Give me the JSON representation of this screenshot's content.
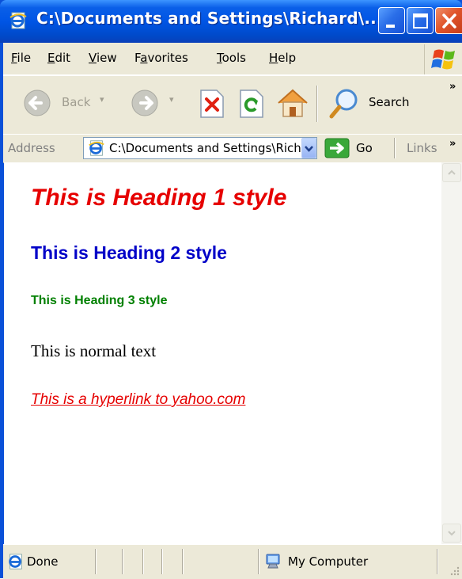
{
  "window": {
    "title": "C:\\Documents and Settings\\Richard\\..."
  },
  "menu": [
    {
      "label": "File",
      "accel": "F",
      "rest": "ile"
    },
    {
      "label": "Edit",
      "accel": "E",
      "rest": "dit"
    },
    {
      "label": "View",
      "accel": "V",
      "rest": "iew"
    },
    {
      "label": "Favorites",
      "pre": "F",
      "accel": "a",
      "rest": "vorites"
    },
    {
      "label": "Tools",
      "accel": "T",
      "rest": "ools"
    },
    {
      "label": "Help",
      "accel": "H",
      "rest": "elp"
    }
  ],
  "toolbar": {
    "back_label": "Back",
    "search_label": "Search",
    "more": "»"
  },
  "address": {
    "label": "Address",
    "value": "C:\\Documents and Settings\\Richard\\",
    "go_label": "Go",
    "links_label": "Links",
    "more": "»"
  },
  "content": {
    "heading1": "This is Heading 1 style",
    "heading2": "This is Heading 2 style",
    "heading3": "This is Heading 3 style",
    "normal_text": "This is normal text",
    "hyperlink": "This is a hyperlink to yahoo.com"
  },
  "status": {
    "left": "Done",
    "zone": "My Computer"
  },
  "colors": {
    "heading1": "#e60000",
    "heading2": "#0000c8",
    "heading3": "#008000",
    "hyperlink": "#e60000",
    "titlebar": "#0055e5"
  },
  "icons": [
    "ie-page-icon",
    "minimize-icon",
    "maximize-icon",
    "close-icon",
    "windows-logo-icon",
    "back-arrow-icon",
    "forward-arrow-icon",
    "stop-icon",
    "refresh-icon",
    "home-icon",
    "search-magnifier-icon",
    "go-arrow-icon",
    "done-page-icon",
    "my-computer-icon"
  ]
}
